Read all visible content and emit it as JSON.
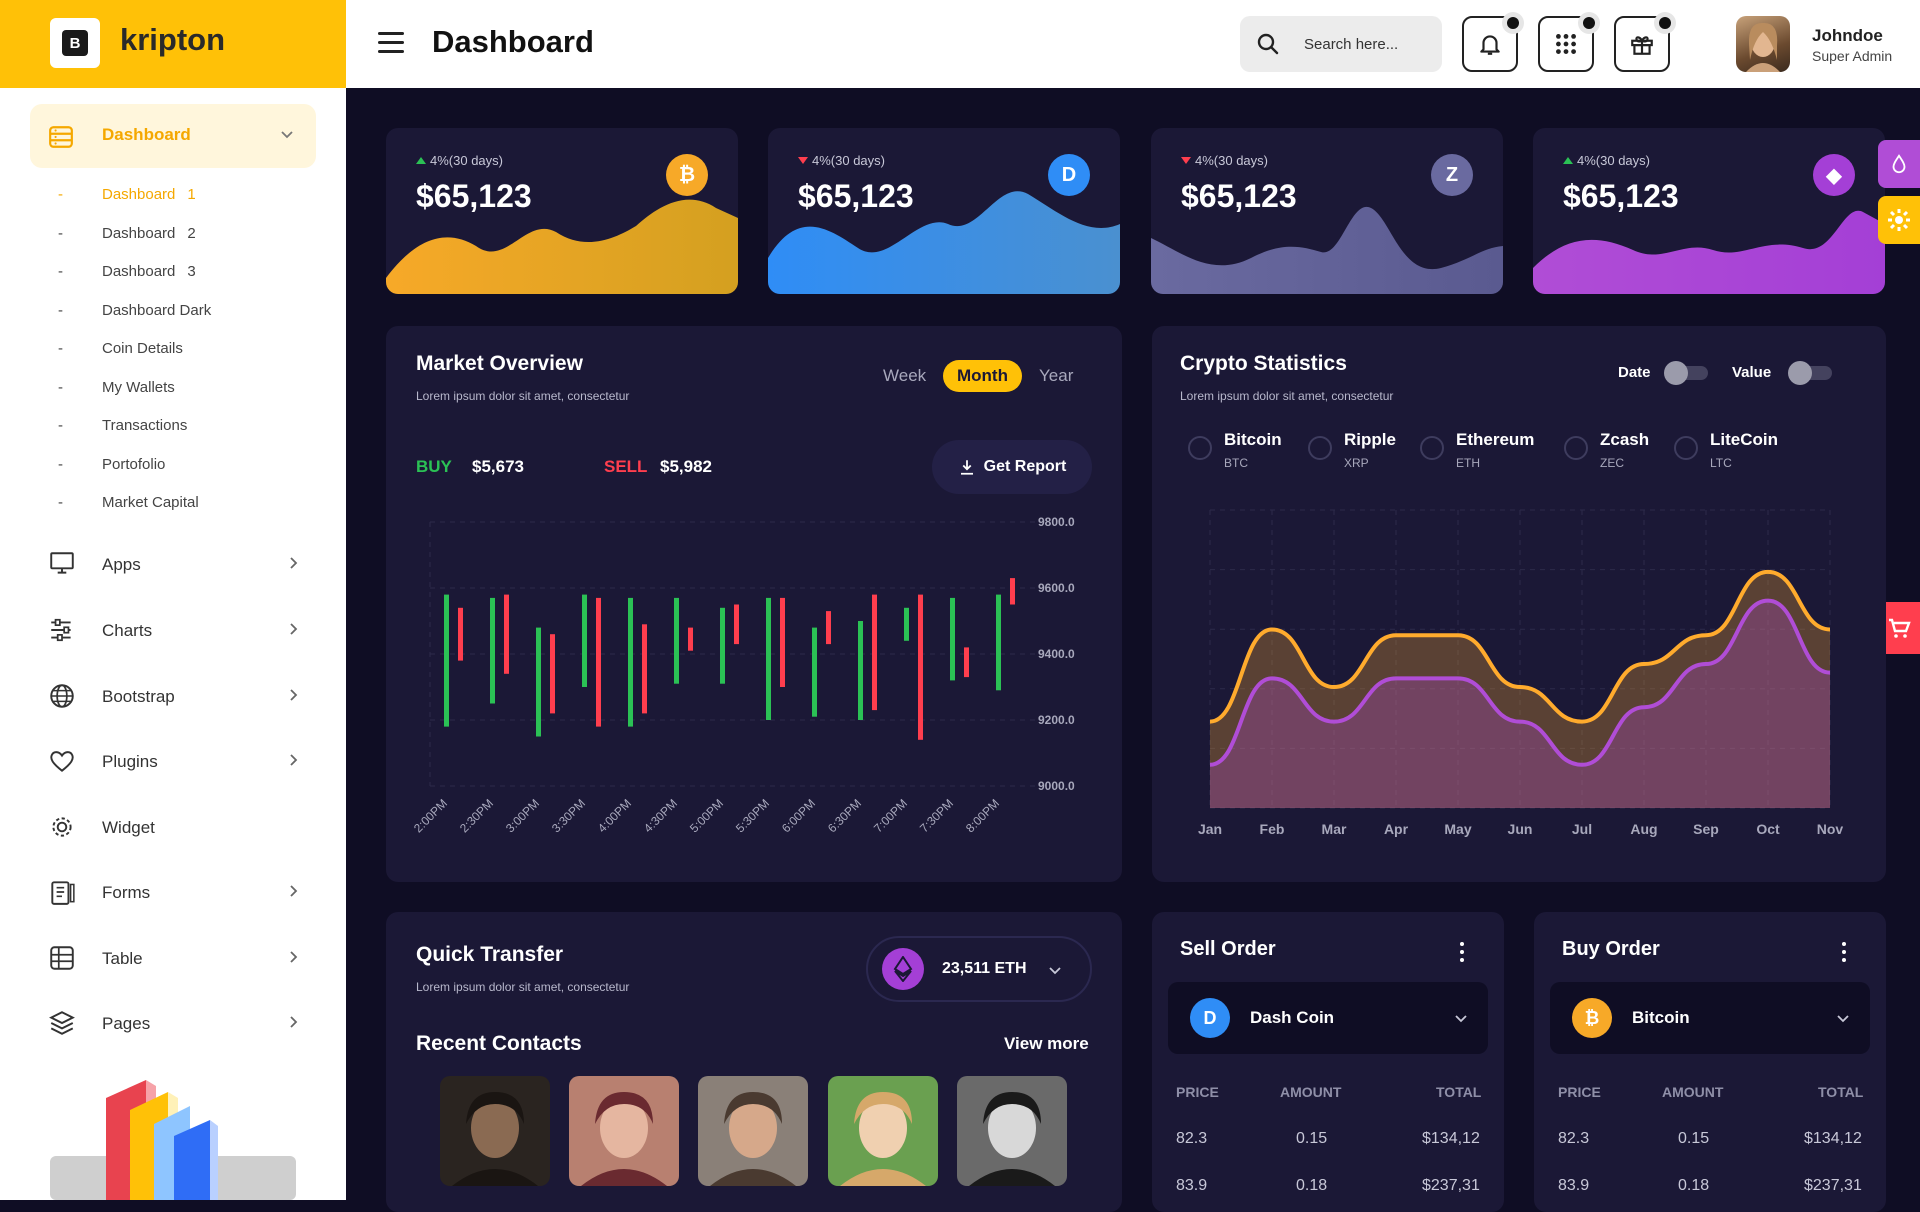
{
  "brand": {
    "name": "kripton",
    "chip_letter": "B"
  },
  "header": {
    "title": "Dashboard",
    "search_placeholder": "Search here...",
    "user": {
      "name": "Johndoe",
      "role": "Super Admin"
    }
  },
  "sidebar": {
    "active": {
      "label": "Dashboard"
    },
    "sub_items": [
      {
        "label": "Dashboard",
        "suffix": "1"
      },
      {
        "label": "Dashboard",
        "suffix": "2"
      },
      {
        "label": "Dashboard",
        "suffix": "3"
      },
      {
        "label": "Dashboard Dark",
        "suffix": ""
      },
      {
        "label": "Coin Details",
        "suffix": ""
      },
      {
        "label": "My Wallets",
        "suffix": ""
      },
      {
        "label": "Transactions",
        "suffix": ""
      },
      {
        "label": "Portofolio",
        "suffix": ""
      },
      {
        "label": "Market Capital",
        "suffix": ""
      }
    ],
    "items": [
      {
        "label": "Apps",
        "icon": "monitor-icon"
      },
      {
        "label": "Charts",
        "icon": "sliders-icon"
      },
      {
        "label": "Bootstrap",
        "icon": "globe-icon"
      },
      {
        "label": "Plugins",
        "icon": "heart-icon"
      },
      {
        "label": "Widget",
        "icon": "gear-icon"
      },
      {
        "label": "Forms",
        "icon": "clipboard-icon"
      },
      {
        "label": "Table",
        "icon": "table-icon"
      },
      {
        "label": "Pages",
        "icon": "layers-icon"
      }
    ]
  },
  "stats": [
    {
      "trend": "4%(30 days)",
      "direction": "up",
      "value": "$65,123",
      "coin": "bitcoin",
      "symbol": "₿",
      "color": "#f7a928"
    },
    {
      "trend": "4%(30 days)",
      "direction": "down",
      "value": "$65,123",
      "coin": "dash",
      "symbol": "D",
      "color": "#2f8df6"
    },
    {
      "trend": "4%(30 days)",
      "direction": "down",
      "value": "$65,123",
      "coin": "zcash",
      "symbol": "Z",
      "color": "#6a6aa0"
    },
    {
      "trend": "4%(30 days)",
      "direction": "up",
      "value": "$65,123",
      "coin": "ethereum",
      "symbol": "◆",
      "color": "#a43fd6"
    }
  ],
  "market": {
    "title": "Market Overview",
    "subtitle": "Lorem ipsum dolor sit amet, consectetur",
    "tabs": [
      "Week",
      "Month",
      "Year"
    ],
    "active_tab": "Month",
    "buy_label": "BUY",
    "buy_value": "$5,673",
    "sell_label": "SELL",
    "sell_value": "$5,982",
    "report_label": "Get Report"
  },
  "crypto": {
    "title": "Crypto Statistics",
    "subtitle": "Lorem ipsum dolor sit amet, consectetur",
    "toggle_date": "Date",
    "toggle_value": "Value",
    "coins": [
      {
        "name": "Bitcoin",
        "symbol": "BTC"
      },
      {
        "name": "Ripple",
        "symbol": "XRP"
      },
      {
        "name": "Ethereum",
        "symbol": "ETH"
      },
      {
        "name": "Zcash",
        "symbol": "ZEC"
      },
      {
        "name": "LiteCoin",
        "symbol": "LTC"
      }
    ]
  },
  "quick_transfer": {
    "title": "Quick Transfer",
    "subtitle": "Lorem ipsum dolor sit amet, consectetur",
    "amount": "23,511 ETH",
    "recent_contacts": "Recent Contacts",
    "view_more": "View more"
  },
  "sell_order": {
    "title": "Sell Order",
    "coin": "Dash Coin",
    "headers": [
      "PRICE",
      "AMOUNT",
      "TOTAL"
    ],
    "rows": [
      [
        "82.3",
        "0.15",
        "$134,12"
      ],
      [
        "83.9",
        "0.18",
        "$237,31"
      ]
    ]
  },
  "buy_order": {
    "title": "Buy Order",
    "coin": "Bitcoin",
    "headers": [
      "PRICE",
      "AMOUNT",
      "TOTAL"
    ],
    "rows": [
      [
        "82.3",
        "0.15",
        "$134,12"
      ],
      [
        "83.9",
        "0.18",
        "$237,31"
      ]
    ]
  },
  "chart_data": [
    {
      "type": "candlestick",
      "title": "Market Overview",
      "categories": [
        "2:00PM",
        "2:30PM",
        "3:00PM",
        "3:30PM",
        "4:00PM",
        "4:30PM",
        "5:00PM",
        "5:30PM",
        "6:00PM",
        "6:30PM",
        "7:00PM",
        "7:30PM",
        "8:00PM"
      ],
      "ylim": [
        9000,
        9800
      ],
      "yticks": [
        "9800.0",
        "9600.0",
        "9400.0",
        "9200.0",
        "9000.0"
      ],
      "series": [
        {
          "color": "#2bc155",
          "values": [
            [
              9180,
              9580
            ],
            [
              9250,
              9570
            ],
            [
              9150,
              9480
            ],
            [
              9300,
              9580
            ],
            [
              9180,
              9570
            ],
            [
              9310,
              9570
            ],
            [
              9310,
              9540
            ],
            [
              9200,
              9570
            ],
            [
              9210,
              9480
            ],
            [
              9200,
              9500
            ],
            [
              9440,
              9540
            ],
            [
              9320,
              9570
            ],
            [
              9290,
              9580
            ]
          ]
        },
        {
          "color": "#ff3e4e",
          "values": [
            [
              9380,
              9540
            ],
            [
              9340,
              9580
            ],
            [
              9220,
              9460
            ],
            [
              9180,
              9570
            ],
            [
              9220,
              9490
            ],
            [
              9410,
              9480
            ],
            [
              9430,
              9550
            ],
            [
              9300,
              9570
            ],
            [
              9430,
              9530
            ],
            [
              9230,
              9580
            ],
            [
              9140,
              9580
            ],
            [
              9330,
              9420
            ],
            [
              9550,
              9630
            ]
          ]
        }
      ]
    },
    {
      "type": "area",
      "title": "Crypto Statistics",
      "categories": [
        "Jan",
        "Feb",
        "Mar",
        "Apr",
        "May",
        "Jun",
        "Jul",
        "Aug",
        "Sep",
        "Oct",
        "Nov"
      ],
      "series": [
        {
          "color": "#ffab2d",
          "values": [
            30,
            62,
            42,
            60,
            60,
            42,
            30,
            50,
            60,
            82,
            62
          ]
        },
        {
          "color": "#b04dd6",
          "values": [
            15,
            45,
            30,
            45,
            45,
            30,
            15,
            35,
            50,
            72,
            47
          ]
        }
      ],
      "ylim": [
        0,
        100
      ]
    }
  ]
}
